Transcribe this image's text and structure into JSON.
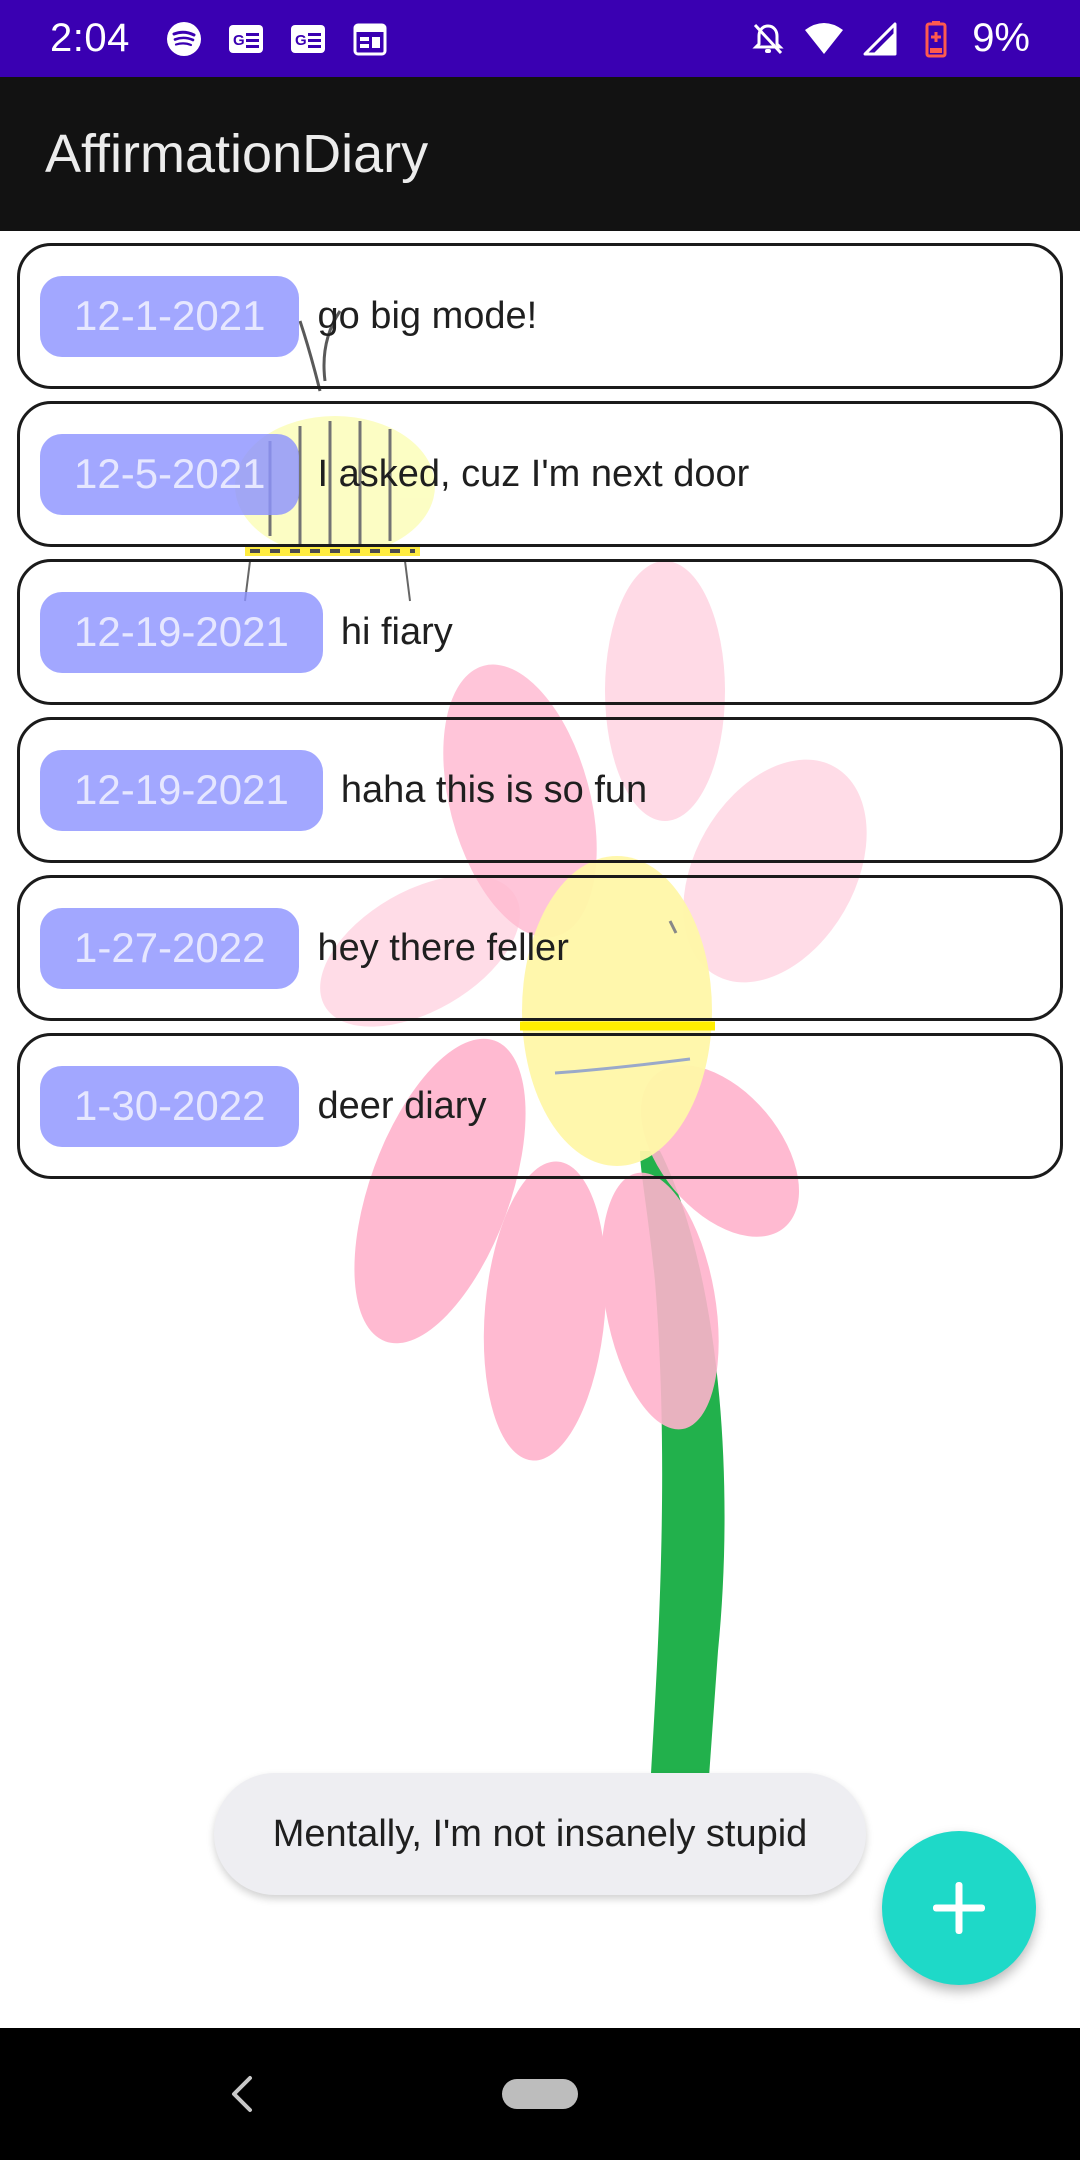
{
  "status_bar": {
    "time": "2:04",
    "battery_percent": "9%",
    "left_icons": [
      "spotify-icon",
      "news-icon",
      "news-icon",
      "calendar-icon"
    ],
    "right_icons": [
      "mute-icon",
      "wifi-icon",
      "signal-icon",
      "battery-icon"
    ],
    "background_color": "#3a00b2"
  },
  "app_bar": {
    "title": "AffirmationDiary",
    "background_color": "#121212"
  },
  "entries": [
    {
      "date": "12-1-2021",
      "text": "go big mode!"
    },
    {
      "date": "12-5-2021",
      "text": "I asked, cuz I'm next door"
    },
    {
      "date": "12-19-2021",
      "text": "hi fiary"
    },
    {
      "date": "12-19-2021",
      "text": "haha this is so fun"
    },
    {
      "date": "1-27-2022",
      "text": "hey there feller"
    },
    {
      "date": "1-30-2022",
      "text": "deer diary"
    }
  ],
  "toast": {
    "text": "Mentally, I'm not insanely stupid"
  },
  "fab": {
    "icon": "plus-icon",
    "color": "#1ed9c8"
  },
  "nav_bar": {
    "icons": [
      "back-icon",
      "home-pill"
    ]
  }
}
